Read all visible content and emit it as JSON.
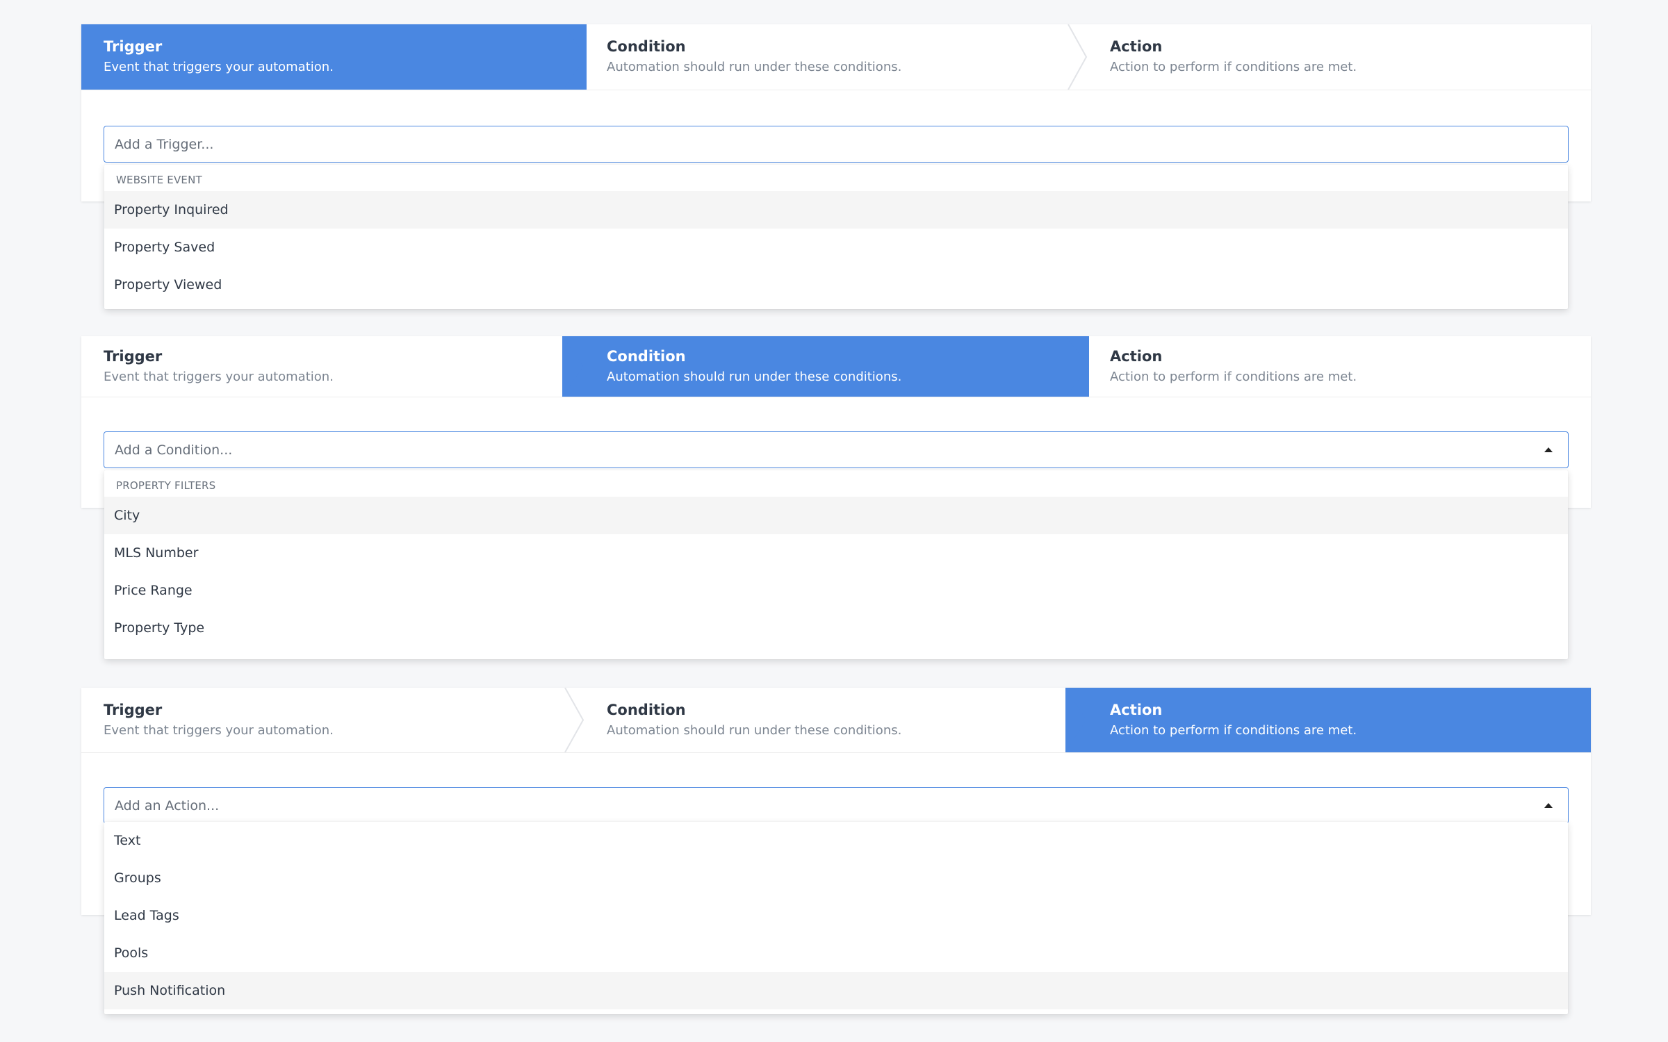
{
  "steps": {
    "trigger": {
      "title": "Trigger",
      "desc": "Event that triggers your automation."
    },
    "condition": {
      "title": "Condition",
      "desc": "Automation should run under these conditions."
    },
    "action": {
      "title": "Action",
      "desc": "Action to perform if conditions are met."
    }
  },
  "trigger_panel": {
    "active_step": "Trigger",
    "input": {
      "placeholder": "Add a Trigger..."
    },
    "dropdown": {
      "group_label": "WEBSITE EVENT",
      "items": [
        "Property Inquired",
        "Property Saved",
        "Property Viewed"
      ],
      "highlighted": "Property Inquired"
    }
  },
  "condition_panel": {
    "active_step": "Condition",
    "input": {
      "placeholder": "Add a Condition..."
    },
    "dropdown": {
      "group_label": "PROPERTY FILTERS",
      "items": [
        "City",
        "MLS Number",
        "Price Range",
        "Property Type"
      ],
      "highlighted": "City"
    }
  },
  "action_panel": {
    "active_step": "Action",
    "input": {
      "placeholder": "Add an Action..."
    },
    "dropdown": {
      "items": [
        "Text",
        "Groups",
        "Lead Tags",
        "Pools",
        "Push Notification"
      ],
      "highlighted": "Push Notification"
    }
  },
  "colors": {
    "accent": "#4a87e1",
    "background": "#f6f7f9",
    "highlight_row": "#f5f5f5",
    "title_text": "#2f3845",
    "desc_text": "#7c8591"
  },
  "icons": {
    "dropdown_caret": "caret-up-icon"
  }
}
